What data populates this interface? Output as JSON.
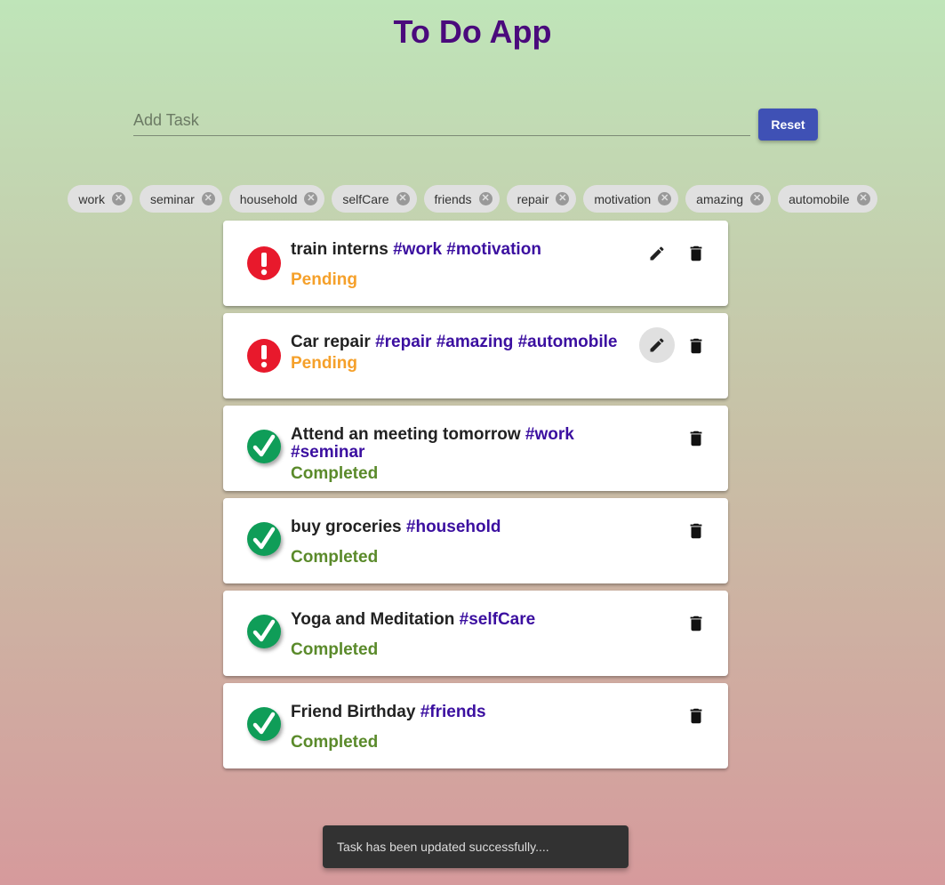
{
  "app": {
    "title": "To Do App"
  },
  "add_task": {
    "placeholder": "Add Task",
    "value": "",
    "reset_label": "Reset"
  },
  "tag_chips": [
    "work",
    "seminar",
    "household",
    "selfCare",
    "friends",
    "repair",
    "motivation",
    "amazing",
    "automobile"
  ],
  "tasks": [
    {
      "text": "train interns",
      "tags": [
        "#work",
        "#motivation"
      ],
      "status": "Pending",
      "editable": true
    },
    {
      "text": "Car repair",
      "tags": [
        "#repair",
        "#amazing",
        "#automobile"
      ],
      "status": "Pending",
      "editable": true
    },
    {
      "text": "Attend an meeting tomorrow",
      "tags": [
        "#work",
        "#seminar"
      ],
      "status": "Completed",
      "editable": false
    },
    {
      "text": "buy groceries",
      "tags": [
        "#household"
      ],
      "status": "Completed",
      "editable": false
    },
    {
      "text": "Yoga and Meditation",
      "tags": [
        "#selfCare"
      ],
      "status": "Completed",
      "editable": false
    },
    {
      "text": "Friend Birthday",
      "tags": [
        "#friends"
      ],
      "status": "Completed",
      "editable": false
    }
  ],
  "snackbar": {
    "message": "Task has been updated successfully...."
  },
  "colors": {
    "title": "#4a0a7c",
    "tag": "#3b0fa0",
    "pending": "#f5a02a",
    "completed": "#5a8a2a",
    "button": "#3f51b5"
  }
}
